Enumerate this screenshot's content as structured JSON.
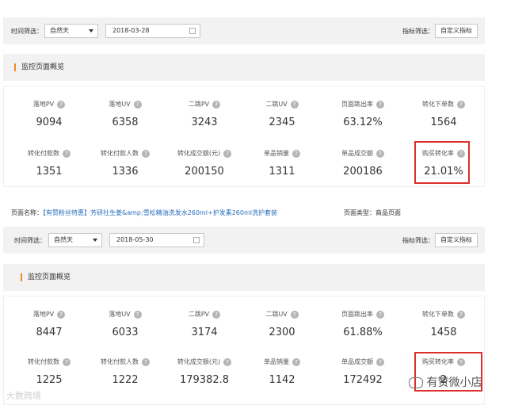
{
  "top": {
    "time_filter_label": "时间筛选：",
    "time_select": "自然天",
    "date": "2018-03-28",
    "indicator_filter_label": "指标筛选：",
    "custom_button": "自定义指标",
    "section_title": "监控页面概览",
    "metrics": [
      {
        "label": "落地PV",
        "value": "9094"
      },
      {
        "label": "落地UV",
        "value": "6358"
      },
      {
        "label": "二跳PV",
        "value": "3243"
      },
      {
        "label": "二跳UV",
        "value": "2345"
      },
      {
        "label": "页面跳出率",
        "value": "63.12%"
      },
      {
        "label": "转化下单数",
        "value": "1564"
      },
      {
        "label": "转化付款数",
        "value": "1351"
      },
      {
        "label": "转化付款人数",
        "value": "1336"
      },
      {
        "label": "转化成交额(元)",
        "value": "200150"
      },
      {
        "label": "单品销量",
        "value": "1311"
      },
      {
        "label": "单品成交额",
        "value": "200186"
      },
      {
        "label": "购买转化率",
        "value": "21.01%"
      }
    ]
  },
  "page_info": {
    "name_label": "页面名称：",
    "name_value": "【有赞粉丝特惠】芳研社生姜&amp;雪松精油洗发水260ml+护发素260ml洗护套装",
    "type_label": "页面类型：商品页面"
  },
  "bottom": {
    "time_filter_label": "时间筛选：",
    "time_select": "自然天",
    "date": "2018-05-30",
    "indicator_filter_label": "指标筛选：",
    "custom_button": "自定义指标",
    "section_title": "监控页面概览",
    "metrics": [
      {
        "label": "落地PV",
        "value": "8447"
      },
      {
        "label": "落地UV",
        "value": "6033"
      },
      {
        "label": "二跳PV",
        "value": "3174"
      },
      {
        "label": "二跳UV",
        "value": "2300"
      },
      {
        "label": "页面跳出率",
        "value": "61.88%"
      },
      {
        "label": "转化下单数",
        "value": "1458"
      },
      {
        "label": "转化付款数",
        "value": "1225"
      },
      {
        "label": "转化付款人数",
        "value": "1222"
      },
      {
        "label": "转化成交额(元)",
        "value": "179382.8"
      },
      {
        "label": "单品销量",
        "value": "1142"
      },
      {
        "label": "单品成交额",
        "value": "172492"
      },
      {
        "label": "购买转化率",
        "value": "2"
      }
    ]
  },
  "watermark_left": "大数跨境",
  "watermark_right": "有赞微小店",
  "colors": {
    "accent": "#f08a24",
    "highlight": "#d9302c",
    "link": "#2a6ebb"
  }
}
